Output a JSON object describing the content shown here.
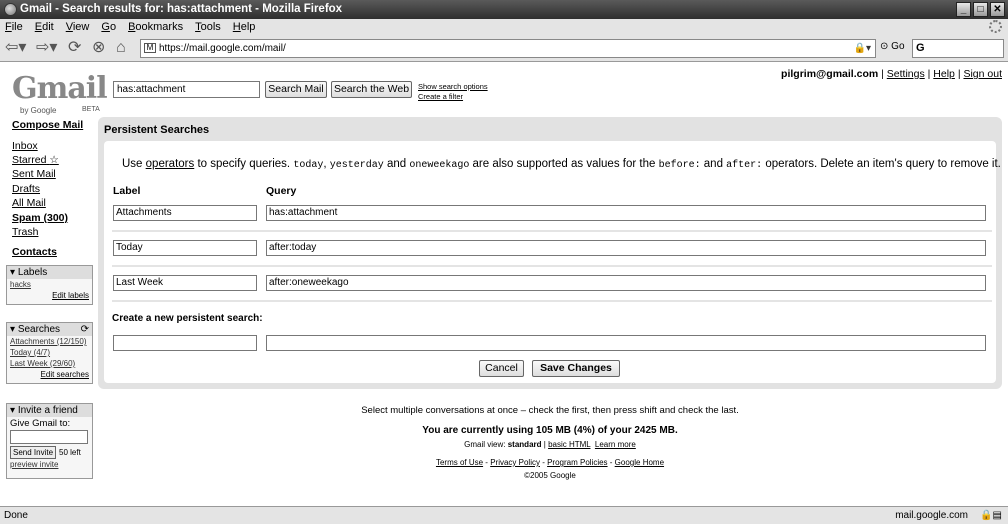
{
  "window": {
    "title": "Gmail - Search results for: has:attachment - Mozilla Firefox"
  },
  "menu": [
    "File",
    "Edit",
    "View",
    "Go",
    "Bookmarks",
    "Tools",
    "Help"
  ],
  "nav": {
    "url": "https://mail.google.com/mail/",
    "go": "Go",
    "search_value": "G"
  },
  "logo": {
    "text": "Gmail",
    "by": "by Google",
    "beta": "BETA"
  },
  "search": {
    "value": "has:attachment",
    "search_mail": "Search Mail",
    "search_web": "Search the Web",
    "show_options": "Show search options",
    "create_filter": "Create a filter"
  },
  "user": {
    "email": "pilgrim@gmail.com",
    "settings": "Settings",
    "help": "Help",
    "signout": "Sign out"
  },
  "sidebar": {
    "compose": "Compose Mail",
    "items": [
      "Inbox",
      "Starred",
      "Sent Mail",
      "Drafts",
      "All Mail",
      "Spam (300)",
      "Trash"
    ],
    "contacts": "Contacts",
    "labels": {
      "title": "Labels",
      "items": [
        "hacks"
      ],
      "edit": "Edit labels"
    },
    "searches": {
      "title": "Searches",
      "items": [
        "Attachments (12/150)",
        "Today (4/7)",
        "Last Week (29/60)"
      ],
      "edit": "Edit searches"
    },
    "invite": {
      "title": "Invite a friend",
      "prompt": "Give Gmail to:",
      "button": "Send Invite",
      "left": "50 left",
      "preview": "preview invite"
    }
  },
  "panel": {
    "title": "Persistent Searches",
    "help": {
      "p1": "Use ",
      "link": "operators",
      "p2": " to specify queries. ",
      "c1": "today",
      "p3": ", ",
      "c2": "yesterday",
      "p4": " and ",
      "c3": "oneweekago",
      "p5": " are also supported as values for the ",
      "c4": "before:",
      "p6": " and ",
      "c5": "after:",
      "p7": " operators. Delete an item's query to remove it."
    },
    "label_header": "Label",
    "query_header": "Query",
    "rows": [
      {
        "label": "Attachments",
        "query": "has:attachment"
      },
      {
        "label": "Today",
        "query": "after:today"
      },
      {
        "label": "Last Week",
        "query": "after:oneweekago"
      }
    ],
    "new_title": "Create a new persistent search:",
    "cancel": "Cancel",
    "save": "Save Changes"
  },
  "footer": {
    "tip": "Select multiple conversations at once – check the first, then press shift and check the last.",
    "usage": "You are currently using 105 MB (4%) of your 2425 MB.",
    "view_label": "Gmail view:",
    "view_standard": "standard",
    "view_basic": "basic HTML",
    "learn": "Learn more",
    "links": [
      "Terms of Use",
      "Privacy Policy",
      "Program Policies",
      "Google Home"
    ],
    "copyright": "©2005 Google"
  },
  "status": {
    "left": "Done",
    "right": "mail.google.com"
  }
}
